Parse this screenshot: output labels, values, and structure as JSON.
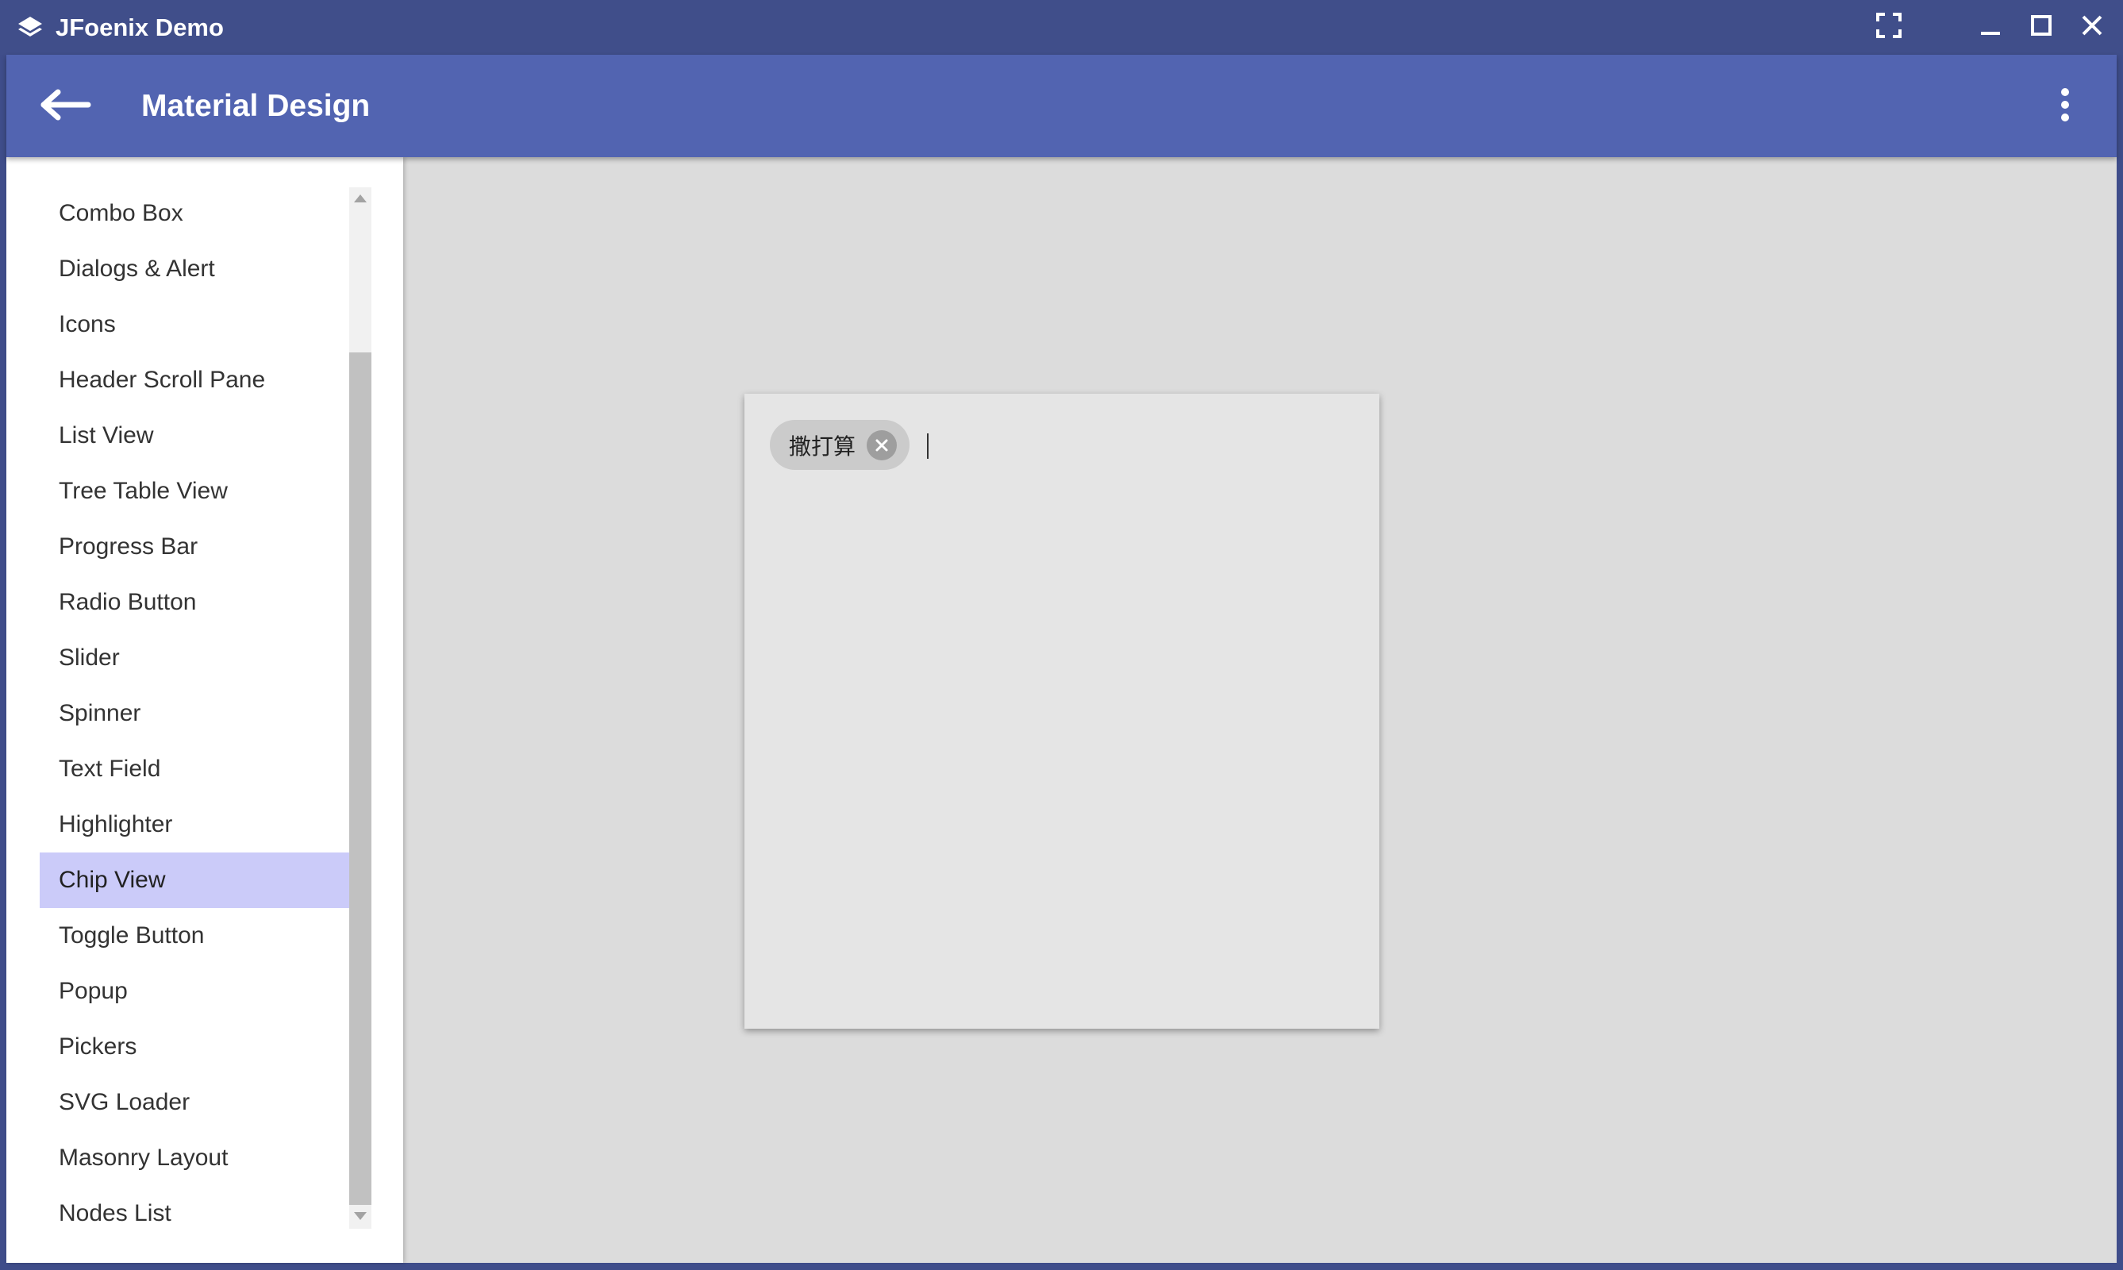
{
  "window": {
    "title": "JFoenix Demo",
    "app_icon": "layers-icon",
    "controls": [
      "fullscreen-icon",
      "minimize-icon",
      "maximize-icon",
      "close-icon"
    ]
  },
  "toolbar": {
    "title": "Material Design",
    "back_icon": "arrow-left-icon",
    "menu_icon": "more-vert-icon"
  },
  "sidebar": {
    "items": [
      {
        "label": "Combo Box"
      },
      {
        "label": "Dialogs & Alert"
      },
      {
        "label": "Icons"
      },
      {
        "label": "Header Scroll Pane"
      },
      {
        "label": "List View"
      },
      {
        "label": "Tree Table View"
      },
      {
        "label": "Progress Bar"
      },
      {
        "label": "Radio Button"
      },
      {
        "label": "Slider"
      },
      {
        "label": "Spinner"
      },
      {
        "label": "Text Field"
      },
      {
        "label": "Highlighter"
      },
      {
        "label": "Chip View"
      },
      {
        "label": "Toggle Button"
      },
      {
        "label": "Popup"
      },
      {
        "label": "Pickers"
      },
      {
        "label": "SVG Loader"
      },
      {
        "label": "Masonry Layout"
      },
      {
        "label": "Nodes List"
      }
    ],
    "selected": "Chip View"
  },
  "chip_view": {
    "chips": [
      {
        "label": "撒打算",
        "remove_icon": "close-circle-icon"
      }
    ],
    "input_value": ""
  },
  "colors": {
    "titlebar": "#404e8a",
    "toolbar": "#5264b1",
    "selected_item": "#cbcbf9",
    "content_bg": "#dcdcdc",
    "card_bg": "#e5e5e5",
    "chip_bg": "#cbcbcb"
  }
}
